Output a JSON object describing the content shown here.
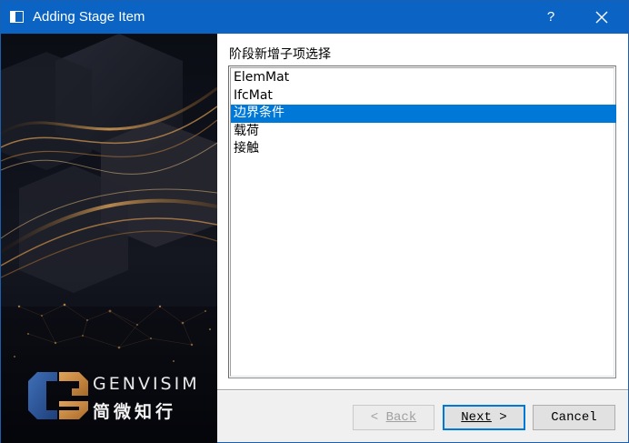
{
  "window": {
    "title": "Adding Stage Item",
    "help_label": "?"
  },
  "brand": {
    "name": "GENVISIM",
    "name_cn": "简微知行"
  },
  "panel": {
    "label": "阶段新增子项选择",
    "items": [
      {
        "label": "ElemMat",
        "selected": false
      },
      {
        "label": "IfcMat",
        "selected": false
      },
      {
        "label": "边界条件",
        "selected": true
      },
      {
        "label": "载荷",
        "selected": false
      },
      {
        "label": "接触",
        "selected": false
      }
    ]
  },
  "buttons": {
    "back": {
      "prefix": "< ",
      "label": "Back",
      "enabled": false
    },
    "next": {
      "label": "Next",
      "suffix": " >",
      "enabled": true
    },
    "cancel": {
      "label": "Cancel",
      "enabled": true
    }
  },
  "colors": {
    "titlebar": "#0b64c4",
    "selection": "#0078d7",
    "banner_gold": "#c98a3c"
  }
}
